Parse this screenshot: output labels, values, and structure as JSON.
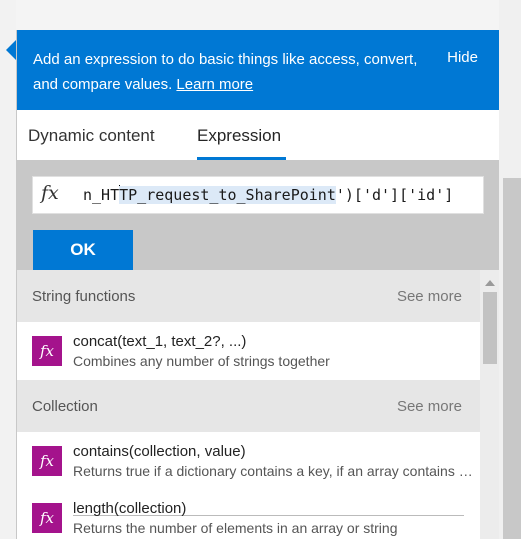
{
  "banner": {
    "text": "Add an expression to do basic things like access, convert, and compare values.",
    "learn_more": "Learn more",
    "hide": "Hide"
  },
  "tabs": [
    {
      "label": "Dynamic content",
      "active": false
    },
    {
      "label": "Expression",
      "active": true
    }
  ],
  "expression": {
    "fx": "fx",
    "pre": "n_HT",
    "selected": "TP_request_to_SharePoint",
    "post": "')['d']['id']",
    "ok_label": "OK"
  },
  "sections": [
    {
      "name": "String functions",
      "see_more": "See more",
      "items": [
        {
          "name": "concat(text_1, text_2?, ...)",
          "desc": "Combines any number of strings together",
          "icon": "fx-icon"
        }
      ]
    },
    {
      "name": "Collection",
      "see_more": "See more",
      "items": [
        {
          "name": "contains(collection, value)",
          "desc": "Returns true if a dictionary contains a key, if an array contains a value, or if a string contains a substring",
          "icon": "fx-icon"
        },
        {
          "name": "length(collection)",
          "desc": "Returns the number of elements in an array or string",
          "icon": "fx-icon"
        }
      ]
    }
  ],
  "colors": {
    "accent": "#0078d4",
    "function_icon": "#a4138c",
    "panel_gray": "#c8c8c8"
  }
}
